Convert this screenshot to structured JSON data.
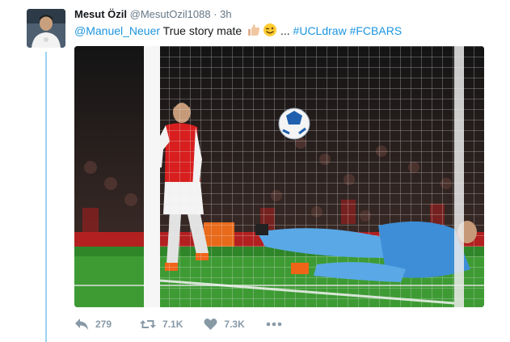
{
  "tweet": {
    "author_name": "Mesut Özil",
    "author_handle": "@MesutOzil1088",
    "separator": "·",
    "timestamp": "3h",
    "mention": "@Manuel_Neuer",
    "text": " True story mate ",
    "ellipsis": " ... ",
    "hashtag1": "#UCLdraw",
    "hashtag2": "#FCBARS",
    "emoji": [
      "thumbs-up-icon",
      "winking-face-icon"
    ]
  },
  "actions": {
    "reply_count": "279",
    "retweet_count": "7.1K",
    "like_count": "7.3K"
  },
  "colors": {
    "link": "#1b95e0",
    "muted": "#657786",
    "thread_line": "#9ad2f0",
    "action_gray": "#8899a6"
  }
}
